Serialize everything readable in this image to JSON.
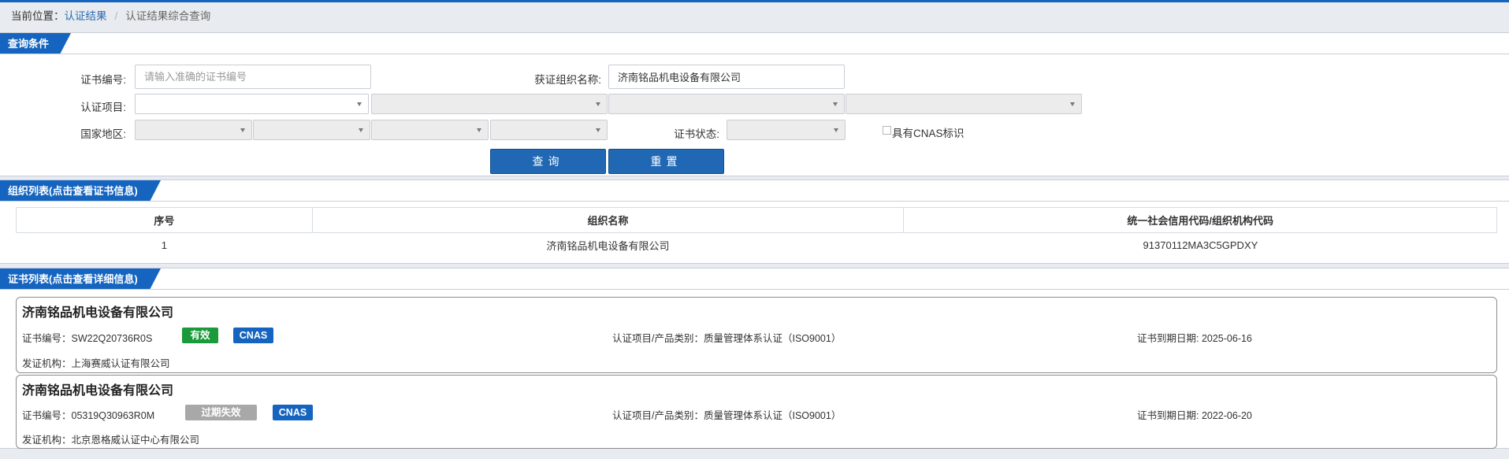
{
  "breadcrumb": {
    "prefix": "当前位置：",
    "link": "认证结果",
    "sep": "/",
    "current": "认证结果综合查询"
  },
  "query": {
    "tab": "查询条件",
    "cert_no_label": "证书编号:",
    "cert_no_placeholder": "请输入准确的证书编号",
    "org_label": "获证组织名称:",
    "org_value": "济南铭品机电设备有限公司",
    "project_label": "认证项目:",
    "region_label": "国家地区:",
    "status_label": "证书状态:",
    "cnas_label": "具有CNAS标识",
    "search_btn": "查询",
    "reset_btn": "重置"
  },
  "org_list": {
    "tab": "组织列表(点击查看证书信息)",
    "columns": [
      "序号",
      "组织名称",
      "统一社会信用代码/组织机构代码"
    ],
    "rows": [
      [
        "1",
        "济南铭品机电设备有限公司",
        "91370112MA3C5GPDXY"
      ]
    ]
  },
  "cert_list": {
    "tab": "证书列表(点击查看详细信息)",
    "items": [
      {
        "org": "济南铭品机电设备有限公司",
        "cert_no": "证书编号：SW22Q20736R0S",
        "status": "有效",
        "status_color": "#1a9a3a",
        "cnas": "CNAS",
        "project": "认证项目/产品类别：质量管理体系认证（ISO9001）",
        "expiry": "证书到期日期: 2025-06-16",
        "issuer": "发证机构：上海赛威认证有限公司"
      },
      {
        "org": "济南铭品机电设备有限公司",
        "cert_no": "证书编号：05319Q30963R0M",
        "status": "过期失效",
        "status_color": "#a8a8a8",
        "cnas": "CNAS",
        "project": "认证项目/产品类别：质量管理体系认证（ISO9001）",
        "expiry": "证书到期日期: 2022-06-20",
        "issuer": "发证机构：北京恩格威认证中心有限公司"
      }
    ]
  },
  "colors": {
    "primary": "#1565c0",
    "button": "#2068b4",
    "cnas_badge": "#1565c0"
  }
}
